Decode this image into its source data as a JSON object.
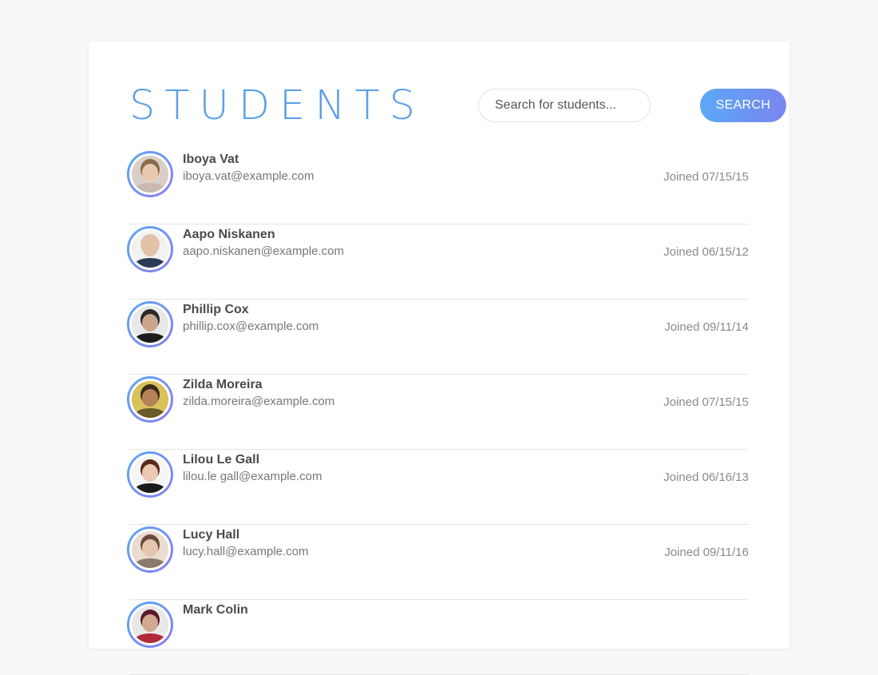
{
  "page": {
    "title": "STUDENTS",
    "accent_color": "#5a9fe8"
  },
  "search": {
    "placeholder": "Search for students...",
    "button_label": "SEARCH"
  },
  "students": [
    {
      "name": "Iboya Vat",
      "email": "iboya.vat@example.com",
      "joined": "Joined 07/15/15",
      "avatar": {
        "bg": "#d9cfc7",
        "hair": "#8a6a4a",
        "skin": "#e8c9b0",
        "shirt": "#c9b9b0"
      }
    },
    {
      "name": "Aapo Niskanen",
      "email": "aapo.niskanen@example.com",
      "joined": "Joined 06/15/12",
      "avatar": {
        "bg": "#f2f2f2",
        "hair": "#e2c2a8",
        "skin": "#e2c2a8",
        "shirt": "#2b3b57"
      }
    },
    {
      "name": "Phillip Cox",
      "email": "phillip.cox@example.com",
      "joined": "Joined 09/11/14",
      "avatar": {
        "bg": "#e8e8e8",
        "hair": "#2a2a2a",
        "skin": "#c9a58a",
        "shirt": "#1c1c1c"
      }
    },
    {
      "name": "Zilda Moreira",
      "email": "zilda.moreira@example.com",
      "joined": "Joined 07/15/15",
      "avatar": {
        "bg": "#d9c25a",
        "hair": "#3a2a1a",
        "skin": "#b5825a",
        "shirt": "#6a5a2a"
      }
    },
    {
      "name": "Lilou Le Gall",
      "email": "lilou.le gall@example.com",
      "joined": "Joined 06/16/13",
      "avatar": {
        "bg": "#f5f5f5",
        "hair": "#5a2a1a",
        "skin": "#ecc7b2",
        "shirt": "#1a1a1a"
      }
    },
    {
      "name": "Lucy Hall",
      "email": "lucy.hall@example.com",
      "joined": "Joined 09/11/16",
      "avatar": {
        "bg": "#e9ddd2",
        "hair": "#6a4a3a",
        "skin": "#e6c4ad",
        "shirt": "#8a7a6a"
      }
    },
    {
      "name": "Mark Colin",
      "email": "",
      "joined": "",
      "avatar": {
        "bg": "#e8e8e8",
        "hair": "#5a1a2a",
        "skin": "#d2a890",
        "shirt": "#b02a3a"
      }
    }
  ]
}
